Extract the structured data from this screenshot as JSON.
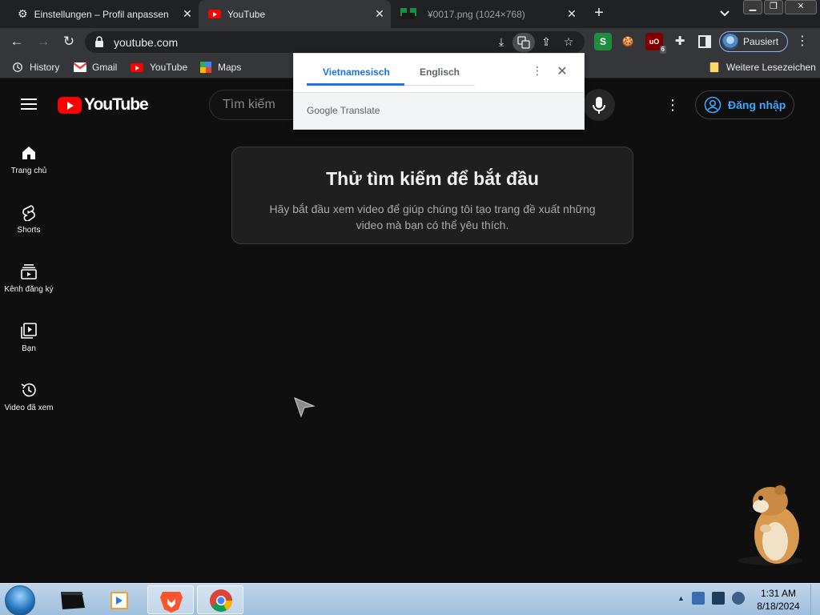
{
  "browser": {
    "tabs": [
      {
        "label": "Einstellungen – Profil anpassen",
        "icon": "gear-icon"
      },
      {
        "label": "YouTube",
        "icon": "youtube-favicon-icon",
        "active": true
      },
      {
        "label": "¥0017.png (1024×768)",
        "icon": "image-favicon-icon"
      }
    ],
    "url": "youtube.com",
    "profile_label": "Pausiert",
    "extensions": [
      "S",
      "🍪",
      "uO"
    ],
    "extension_badge": "6",
    "bookmarks": [
      {
        "label": "History",
        "icon": "history-icon"
      },
      {
        "label": "Gmail",
        "icon": "gmail-icon"
      },
      {
        "label": "YouTube",
        "icon": "youtube-favicon-icon"
      },
      {
        "label": "Maps",
        "icon": "maps-icon"
      }
    ],
    "other_bookmarks": "Weitere Lesezeichen"
  },
  "translate_popup": {
    "source_language": "Vietnamesisch",
    "target_language": "Englisch",
    "brand_google": "Google",
    "brand_translate": "Translate"
  },
  "youtube": {
    "logo_text": "YouTube",
    "search_placeholder": "Tìm kiếm",
    "signin_label": "Đăng nhập",
    "guide": [
      {
        "label": "Trang chủ",
        "icon": "home-icon"
      },
      {
        "label": "Shorts",
        "icon": "shorts-icon"
      },
      {
        "label": "Kênh đăng ký",
        "icon": "subscriptions-icon"
      },
      {
        "label": "Bạn",
        "icon": "you-library-icon"
      },
      {
        "label": "Video đã xem",
        "icon": "history-icon"
      }
    ],
    "prompt_title": "Thử tìm kiếm để bắt đầu",
    "prompt_body": "Hãy bắt đầu xem video để giúp chúng tôi tạo trang đề xuất những video mà bạn có thể yêu thích."
  },
  "taskbar": {
    "time": "1:31 AM",
    "date": "8/18/2024"
  },
  "colors": {
    "accent_blue": "#3ea6ff",
    "youtube_red": "#ff0000",
    "translate_blue": "#1a73e8"
  }
}
